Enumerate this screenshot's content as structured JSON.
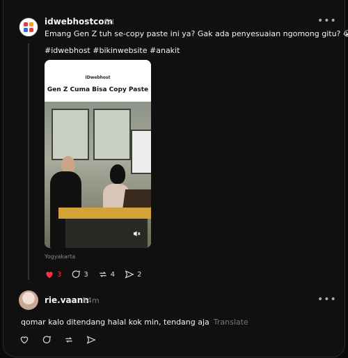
{
  "post": {
    "username": "idwebhostcom",
    "time": "5d",
    "text": "Emang Gen Z tuh se-copy paste ini ya? Gak ada penyesuaian ngomong gitu? 😭",
    "hashtags": "#idwebhost #bikinwebsite #anakit",
    "media": {
      "brand": "IDwebhost",
      "headline": "Gen Z Cuma Bisa Copy Paste"
    },
    "location": "Yogyakarta",
    "likes": "3",
    "comments": "3",
    "reposts": "4",
    "shares": "2",
    "more": "•••"
  },
  "reply": {
    "username": "rie.vaann",
    "time": "14m",
    "text": "qomar kalo ditendang halal kok min, tendang aja",
    "translate": "Translate",
    "more": "•••"
  },
  "colors": {
    "like_red": "#ff3040",
    "background": "#101010"
  },
  "icons": [
    "heart-icon",
    "comment-icon",
    "repost-icon",
    "share-icon",
    "mute-icon",
    "more-icon"
  ]
}
